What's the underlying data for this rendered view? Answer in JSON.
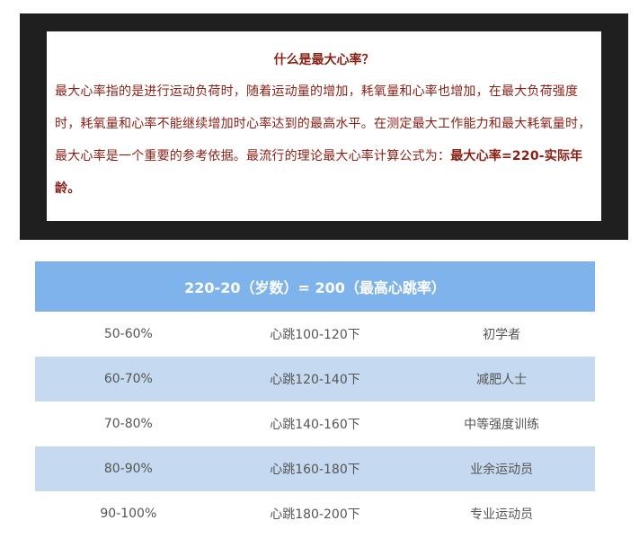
{
  "article": {
    "title": "什么是最大心率？",
    "body": "最大心率指的是进行运动负荷时，随着运动量的增加，耗氧量和心率也增加，在最大负荷强度时，耗氧量和心率不能继续增加时心率达到的最高水平。在测定最大工作能力和最大耗氧量时，最大心率是一个重要的参考依据。最流行的理论最大心率计算公式为：",
    "formula": "最大心率=220-实际年龄。"
  },
  "table": {
    "header": "220-20（岁数）= 200（最高心跳率）",
    "rows": [
      {
        "percent": "50-60%",
        "heartbeat": "心跳100-120下",
        "group": "初学者"
      },
      {
        "percent": "60-70%",
        "heartbeat": "心跳120-140下",
        "group": "减肥人士"
      },
      {
        "percent": "70-80%",
        "heartbeat": "心跳140-160下",
        "group": "中等强度训练"
      },
      {
        "percent": "80-90%",
        "heartbeat": "心跳160-180下",
        "group": "业余运动员"
      },
      {
        "percent": "90-100%",
        "heartbeat": "心跳180-200下",
        "group": "专业运动员"
      }
    ],
    "colors": {
      "header_bg": "#7fb3ec",
      "stripe_bg": "#c5d9f0",
      "text_accent": "#8a1f14"
    }
  }
}
